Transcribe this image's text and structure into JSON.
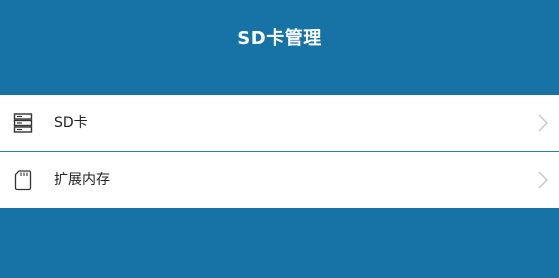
{
  "header": {
    "title": "SD卡管理"
  },
  "list": {
    "items": [
      {
        "label": "SD卡",
        "icon": "storage-icon"
      },
      {
        "label": "扩展内存",
        "icon": "sd-card-icon"
      }
    ]
  },
  "colors": {
    "primary": "#1773a6",
    "background": "#ffffff",
    "divider": "#2b7fb1",
    "text": "#222222",
    "chevron": "#c7c7c7"
  }
}
